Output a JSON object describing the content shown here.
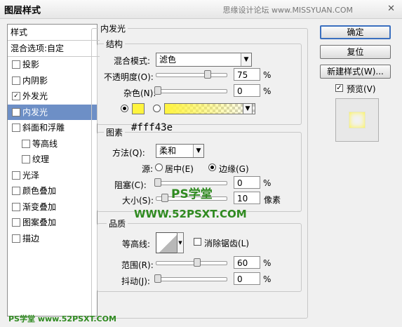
{
  "window": {
    "title": "图层样式",
    "watermark": "思缘设计论坛  www.MISSYUAN.COM",
    "close": "✕"
  },
  "left_panel": {
    "header_styles": "样式",
    "header_blend": "混合选项:自定",
    "items": [
      {
        "label": "投影",
        "checked": false
      },
      {
        "label": "内阴影",
        "checked": false
      },
      {
        "label": "外发光",
        "checked": true
      },
      {
        "label": "内发光",
        "checked": true
      },
      {
        "label": "斜面和浮雕",
        "checked": false
      },
      {
        "label": "等高线",
        "checked": false
      },
      {
        "label": "纹理",
        "checked": false
      },
      {
        "label": "光泽",
        "checked": false
      },
      {
        "label": "颜色叠加",
        "checked": false
      },
      {
        "label": "渐变叠加",
        "checked": false
      },
      {
        "label": "图案叠加",
        "checked": false
      },
      {
        "label": "描边",
        "checked": false
      }
    ]
  },
  "panel_title": "内发光",
  "structure": {
    "legend": "结构",
    "blend_mode_label": "混合模式:",
    "blend_mode_value": "滤色",
    "opacity_label": "不透明度(O):",
    "opacity_value": "75",
    "opacity_unit": "%",
    "opacity_level": 0.75,
    "noise_label": "杂色(N):",
    "noise_value": "0",
    "noise_unit": "%",
    "noise_level": 0,
    "color_hex": "#fff43e"
  },
  "elements": {
    "legend": "图素",
    "annotation": "#fff43e",
    "technique_label": "方法(Q):",
    "technique_value": "柔和",
    "source_label": "源:",
    "source_center": "居中(E)",
    "source_edge": "边缘(G)",
    "choke_label": "阻塞(C):",
    "choke_value": "0",
    "choke_unit": "%",
    "size_label": "大小(S):",
    "size_value": "10",
    "size_unit": "像素",
    "logo_text": "PS学堂",
    "logo_url": "WWW.52PSXT.COM"
  },
  "quality": {
    "legend": "品质",
    "contour_label": "等高线:",
    "anti_alias_label": "消除锯齿(L)",
    "range_label": "范围(R):",
    "range_value": "60",
    "range_unit": "%",
    "range_level": 0.6,
    "jitter_label": "抖动(J):",
    "jitter_value": "0",
    "jitter_unit": "%"
  },
  "buttons": {
    "ok": "确定",
    "reset": "复位",
    "new_style": "新建样式(W)...",
    "preview_label": "预览(V)"
  },
  "footer_watermark": "PS学堂 www.52PSXT.COM"
}
